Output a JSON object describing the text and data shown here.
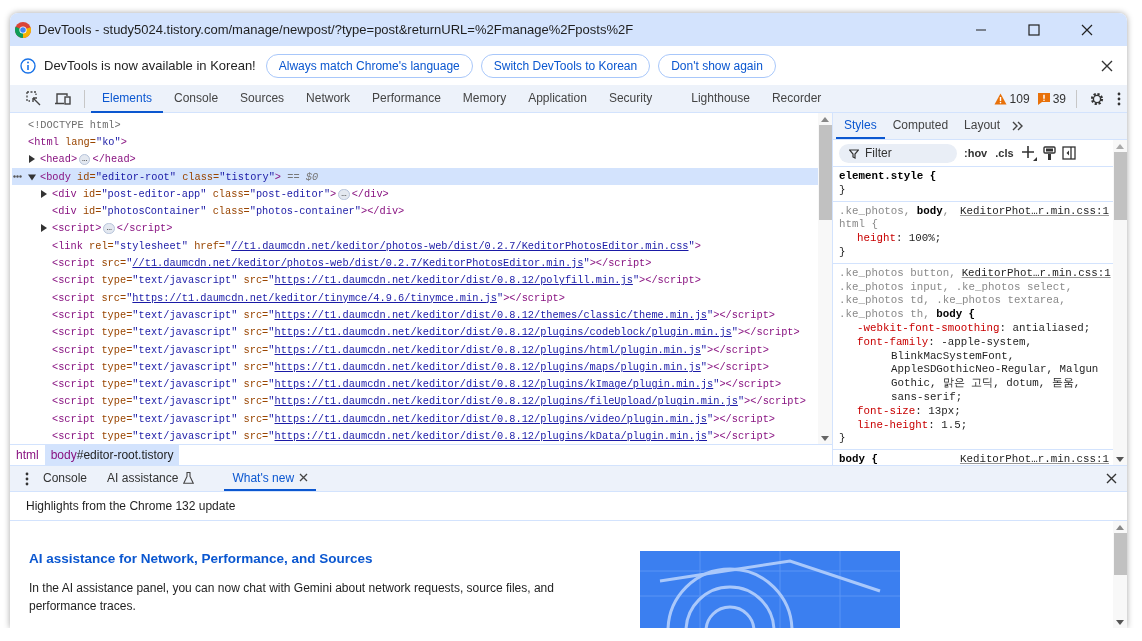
{
  "window": {
    "title": "DevTools - study5024.tistory.com/manage/newpost/?type=post&returnURL=%2Fmanage%2Fposts%2F"
  },
  "infobar": {
    "message": "DevTools is now available in Korean!",
    "buttons": [
      "Always match Chrome's language",
      "Switch DevTools to Korean",
      "Don't show again"
    ]
  },
  "toolbar": {
    "tabs": [
      {
        "label": "Elements",
        "selected": true
      },
      {
        "label": "Console",
        "selected": false
      },
      {
        "label": "Sources",
        "selected": false
      },
      {
        "label": "Network",
        "selected": false
      },
      {
        "label": "Performance",
        "selected": false
      },
      {
        "label": "Memory",
        "selected": false
      },
      {
        "label": "Application",
        "selected": false
      },
      {
        "label": "Security",
        "selected": false
      },
      {
        "label": "Lighthouse",
        "selected": false
      },
      {
        "label": "Recorder",
        "selected": false
      }
    ],
    "warnings": "109",
    "errors": "39"
  },
  "elements": {
    "nodes": [
      {
        "selected": false,
        "tokens": [
          {
            "kind": "doctype",
            "text": "<!DOCTYPE html>"
          }
        ]
      },
      {
        "selected": false,
        "tokens": [
          {
            "kind": "tag",
            "text": "<html"
          },
          {
            "kind": "attr",
            "text": " lang="
          },
          {
            "kind": "val",
            "text": "\"ko\""
          },
          {
            "kind": "tag",
            "text": ">"
          }
        ],
        "children": [
          {
            "selected": false,
            "expanded": false,
            "tokens": [
              {
                "kind": "tag",
                "text": "<head>"
              },
              {
                "kind": "badge",
                "text": "…"
              },
              {
                "kind": "tag",
                "text": "</head>"
              }
            ]
          },
          {
            "selected": true,
            "expanded": true,
            "tokens": [
              {
                "kind": "tag",
                "text": "<body"
              },
              {
                "kind": "attr",
                "text": " id="
              },
              {
                "kind": "val",
                "text": "\"editor-root\""
              },
              {
                "kind": "attr",
                "text": " class="
              },
              {
                "kind": "val",
                "text": "\"tistory\""
              },
              {
                "kind": "tag",
                "text": ">"
              },
              {
                "kind": "ref",
                "text": " == $0"
              }
            ],
            "children": [
              {
                "selected": false,
                "expanded": false,
                "tokens": [
                  {
                    "kind": "tag",
                    "text": "<div"
                  },
                  {
                    "kind": "attr",
                    "text": " id="
                  },
                  {
                    "kind": "val",
                    "text": "\"post-editor-app\""
                  },
                  {
                    "kind": "attr",
                    "text": " class="
                  },
                  {
                    "kind": "val",
                    "text": "\"post-editor\""
                  },
                  {
                    "kind": "tag",
                    "text": ">"
                  },
                  {
                    "kind": "badge",
                    "text": "…"
                  },
                  {
                    "kind": "tag",
                    "text": "</div>"
                  }
                ]
              },
              {
                "selected": false,
                "tokens": [
                  {
                    "kind": "tag",
                    "text": "<div"
                  },
                  {
                    "kind": "attr",
                    "text": " id="
                  },
                  {
                    "kind": "val",
                    "text": "\"photosContainer\""
                  },
                  {
                    "kind": "attr",
                    "text": " class="
                  },
                  {
                    "kind": "val",
                    "text": "\"photos-container\""
                  },
                  {
                    "kind": "tag",
                    "text": "></div>"
                  }
                ]
              },
              {
                "selected": false,
                "expanded": false,
                "tokens": [
                  {
                    "kind": "tag",
                    "text": "<script>"
                  },
                  {
                    "kind": "badge",
                    "text": "…"
                  },
                  {
                    "kind": "tag",
                    "text": "</script>"
                  }
                ]
              },
              {
                "selected": false,
                "tokens": [
                  {
                    "kind": "tag",
                    "text": "<link"
                  },
                  {
                    "kind": "attr",
                    "text": " rel="
                  },
                  {
                    "kind": "val",
                    "text": "\"stylesheet\""
                  },
                  {
                    "kind": "attr",
                    "text": " href="
                  },
                  {
                    "kind": "val",
                    "text": "\""
                  },
                  {
                    "kind": "link",
                    "text": "//t1.daumcdn.net/keditor/photos-web/dist/0.2.7/KeditorPhotosEditor.min.css"
                  },
                  {
                    "kind": "val",
                    "text": "\""
                  },
                  {
                    "kind": "tag",
                    "text": ">"
                  }
                ]
              },
              {
                "selected": false,
                "tokens": [
                  {
                    "kind": "tag",
                    "text": "<script"
                  },
                  {
                    "kind": "attr",
                    "text": " src="
                  },
                  {
                    "kind": "val",
                    "text": "\""
                  },
                  {
                    "kind": "link",
                    "text": "//t1.daumcdn.net/keditor/photos-web/dist/0.2.7/KeditorPhotosEditor.min.js"
                  },
                  {
                    "kind": "val",
                    "text": "\""
                  },
                  {
                    "kind": "tag",
                    "text": "></script>"
                  }
                ]
              },
              {
                "selected": false,
                "tokens": [
                  {
                    "kind": "tag",
                    "text": "<script"
                  },
                  {
                    "kind": "attr",
                    "text": " type="
                  },
                  {
                    "kind": "val",
                    "text": "\"text/javascript\""
                  },
                  {
                    "kind": "attr",
                    "text": " src="
                  },
                  {
                    "kind": "val",
                    "text": "\""
                  },
                  {
                    "kind": "link",
                    "text": "https://t1.daumcdn.net/keditor/dist/0.8.12/polyfill.min.js"
                  },
                  {
                    "kind": "val",
                    "text": "\""
                  },
                  {
                    "kind": "tag",
                    "text": "></script>"
                  }
                ]
              },
              {
                "selected": false,
                "tokens": [
                  {
                    "kind": "tag",
                    "text": "<script"
                  },
                  {
                    "kind": "attr",
                    "text": " src="
                  },
                  {
                    "kind": "val",
                    "text": "\""
                  },
                  {
                    "kind": "link",
                    "text": "https://t1.daumcdn.net/keditor/tinymce/4.9.6/tinymce.min.js"
                  },
                  {
                    "kind": "val",
                    "text": "\""
                  },
                  {
                    "kind": "tag",
                    "text": "></script>"
                  }
                ]
              },
              {
                "selected": false,
                "tokens": [
                  {
                    "kind": "tag",
                    "text": "<script"
                  },
                  {
                    "kind": "attr",
                    "text": " type="
                  },
                  {
                    "kind": "val",
                    "text": "\"text/javascript\""
                  },
                  {
                    "kind": "attr",
                    "text": " src="
                  },
                  {
                    "kind": "val",
                    "text": "\""
                  },
                  {
                    "kind": "link",
                    "text": "https://t1.daumcdn.net/keditor/dist/0.8.12/themes/classic/theme.min.js"
                  },
                  {
                    "kind": "val",
                    "text": "\""
                  },
                  {
                    "kind": "tag",
                    "text": "></script>"
                  }
                ]
              },
              {
                "selected": false,
                "tokens": [
                  {
                    "kind": "tag",
                    "text": "<script"
                  },
                  {
                    "kind": "attr",
                    "text": " type="
                  },
                  {
                    "kind": "val",
                    "text": "\"text/javascript\""
                  },
                  {
                    "kind": "attr",
                    "text": " src="
                  },
                  {
                    "kind": "val",
                    "text": "\""
                  },
                  {
                    "kind": "link",
                    "text": "https://t1.daumcdn.net/keditor/dist/0.8.12/plugins/codeblock/plugin.min.js"
                  },
                  {
                    "kind": "val",
                    "text": "\""
                  },
                  {
                    "kind": "tag",
                    "text": "></script>"
                  }
                ]
              },
              {
                "selected": false,
                "tokens": [
                  {
                    "kind": "tag",
                    "text": "<script"
                  },
                  {
                    "kind": "attr",
                    "text": " type="
                  },
                  {
                    "kind": "val",
                    "text": "\"text/javascript\""
                  },
                  {
                    "kind": "attr",
                    "text": " src="
                  },
                  {
                    "kind": "val",
                    "text": "\""
                  },
                  {
                    "kind": "link",
                    "text": "https://t1.daumcdn.net/keditor/dist/0.8.12/plugins/html/plugin.min.js"
                  },
                  {
                    "kind": "val",
                    "text": "\""
                  },
                  {
                    "kind": "tag",
                    "text": "></script>"
                  }
                ]
              },
              {
                "selected": false,
                "tokens": [
                  {
                    "kind": "tag",
                    "text": "<script"
                  },
                  {
                    "kind": "attr",
                    "text": " type="
                  },
                  {
                    "kind": "val",
                    "text": "\"text/javascript\""
                  },
                  {
                    "kind": "attr",
                    "text": " src="
                  },
                  {
                    "kind": "val",
                    "text": "\""
                  },
                  {
                    "kind": "link",
                    "text": "https://t1.daumcdn.net/keditor/dist/0.8.12/plugins/maps/plugin.min.js"
                  },
                  {
                    "kind": "val",
                    "text": "\""
                  },
                  {
                    "kind": "tag",
                    "text": "></script>"
                  }
                ]
              },
              {
                "selected": false,
                "tokens": [
                  {
                    "kind": "tag",
                    "text": "<script"
                  },
                  {
                    "kind": "attr",
                    "text": " type="
                  },
                  {
                    "kind": "val",
                    "text": "\"text/javascript\""
                  },
                  {
                    "kind": "attr",
                    "text": " src="
                  },
                  {
                    "kind": "val",
                    "text": "\""
                  },
                  {
                    "kind": "link",
                    "text": "https://t1.daumcdn.net/keditor/dist/0.8.12/plugins/kImage/plugin.min.js"
                  },
                  {
                    "kind": "val",
                    "text": "\""
                  },
                  {
                    "kind": "tag",
                    "text": "></script>"
                  }
                ]
              },
              {
                "selected": false,
                "tokens": [
                  {
                    "kind": "tag",
                    "text": "<script"
                  },
                  {
                    "kind": "attr",
                    "text": " type="
                  },
                  {
                    "kind": "val",
                    "text": "\"text/javascript\""
                  },
                  {
                    "kind": "attr",
                    "text": " src="
                  },
                  {
                    "kind": "val",
                    "text": "\""
                  },
                  {
                    "kind": "link",
                    "text": "https://t1.daumcdn.net/keditor/dist/0.8.12/plugins/fileUpload/plugin.min.js"
                  },
                  {
                    "kind": "val",
                    "text": "\""
                  },
                  {
                    "kind": "tag",
                    "text": "></script>"
                  }
                ]
              },
              {
                "selected": false,
                "tokens": [
                  {
                    "kind": "tag",
                    "text": "<script"
                  },
                  {
                    "kind": "attr",
                    "text": " type="
                  },
                  {
                    "kind": "val",
                    "text": "\"text/javascript\""
                  },
                  {
                    "kind": "attr",
                    "text": " src="
                  },
                  {
                    "kind": "val",
                    "text": "\""
                  },
                  {
                    "kind": "link",
                    "text": "https://t1.daumcdn.net/keditor/dist/0.8.12/plugins/video/plugin.min.js"
                  },
                  {
                    "kind": "val",
                    "text": "\""
                  },
                  {
                    "kind": "tag",
                    "text": "></script>"
                  }
                ]
              },
              {
                "selected": false,
                "tokens": [
                  {
                    "kind": "tag",
                    "text": "<script"
                  },
                  {
                    "kind": "attr",
                    "text": " type="
                  },
                  {
                    "kind": "val",
                    "text": "\"text/javascript\""
                  },
                  {
                    "kind": "attr",
                    "text": " src="
                  },
                  {
                    "kind": "val",
                    "text": "\""
                  },
                  {
                    "kind": "link",
                    "text": "https://t1.daumcdn.net/keditor/dist/0.8.12/plugins/kData/plugin.min.js"
                  },
                  {
                    "kind": "val",
                    "text": "\""
                  },
                  {
                    "kind": "tag",
                    "text": "></script>"
                  }
                ]
              }
            ]
          }
        ]
      }
    ]
  },
  "breadcrumbs": [
    {
      "tag": "html",
      "selected": false
    },
    {
      "tag": "body",
      "rest": "#editor-root.tistory",
      "selected": true
    }
  ],
  "styles": {
    "tabs": [
      {
        "label": "Styles",
        "selected": true
      },
      {
        "label": "Computed",
        "selected": false
      },
      {
        "label": "Layout",
        "selected": false
      }
    ],
    "filter": {
      "placeholder": "Filter"
    },
    "toggles": [
      ":hov",
      ".cls"
    ],
    "rules": [
      {
        "lines": [
          {
            "parts": [
              {
                "text": "element.style {",
                "matched": true
              }
            ]
          }
        ],
        "close": "}"
      },
      {
        "source": "KeditorPhot…r.min.css:1",
        "lines": [
          {
            "parts": [
              {
                "text": ".ke_photos, ",
                "matched": false
              },
              {
                "text": "body",
                "matched": true
              },
              {
                "text": ",",
                "matched": false
              }
            ]
          },
          {
            "parts": [
              {
                "text": "html {",
                "matched": false
              }
            ]
          }
        ],
        "props": [
          {
            "name": "height",
            "value": ": 100%;"
          }
        ],
        "close": "}"
      },
      {
        "source": "KeditorPhot…r.min.css:1",
        "lines": [
          {
            "parts": [
              {
                "text": ".ke_photos button,",
                "matched": false
              }
            ]
          },
          {
            "parts": [
              {
                "text": ".ke_photos input, .ke_photos select,",
                "matched": false
              }
            ]
          },
          {
            "parts": [
              {
                "text": ".ke_photos td, .ke_photos textarea,",
                "matched": false
              }
            ]
          },
          {
            "parts": [
              {
                "text": ".ke_photos th, ",
                "matched": false
              },
              {
                "text": "body {",
                "matched": true
              }
            ]
          }
        ],
        "props": [
          {
            "name": "-webkit-font-smoothing",
            "value": ": antialiased;"
          },
          {
            "name": "font-family",
            "value": ": -apple-system, BlinkMacSystemFont, AppleSDGothicNeo-Regular, Malgun Gothic, 맑은 고딕, dotum, 돋움, sans-serif;"
          },
          {
            "name": "font-size",
            "value": ": 13px;"
          },
          {
            "name": "line-height",
            "value": ": 1.5;"
          }
        ],
        "close": "}"
      },
      {
        "source": "KeditorPhot…r.min.css:1",
        "lines": [
          {
            "parts": [
              {
                "text": "body {",
                "matched": true
              }
            ]
          }
        ]
      }
    ]
  },
  "drawer": {
    "tabs": [
      {
        "label": "Console",
        "selected": false,
        "kind": "plain"
      },
      {
        "label": "AI assistance",
        "selected": false,
        "kind": "experimental"
      },
      {
        "label": "What's new",
        "selected": true,
        "kind": "closable"
      }
    ],
    "header": "Highlights from the Chrome 132 update",
    "article": {
      "title": "AI assistance for Network, Performance, and Sources",
      "body": "In the AI assistance panel, you can now chat with Gemini about network requests, source files, and performance traces."
    }
  }
}
